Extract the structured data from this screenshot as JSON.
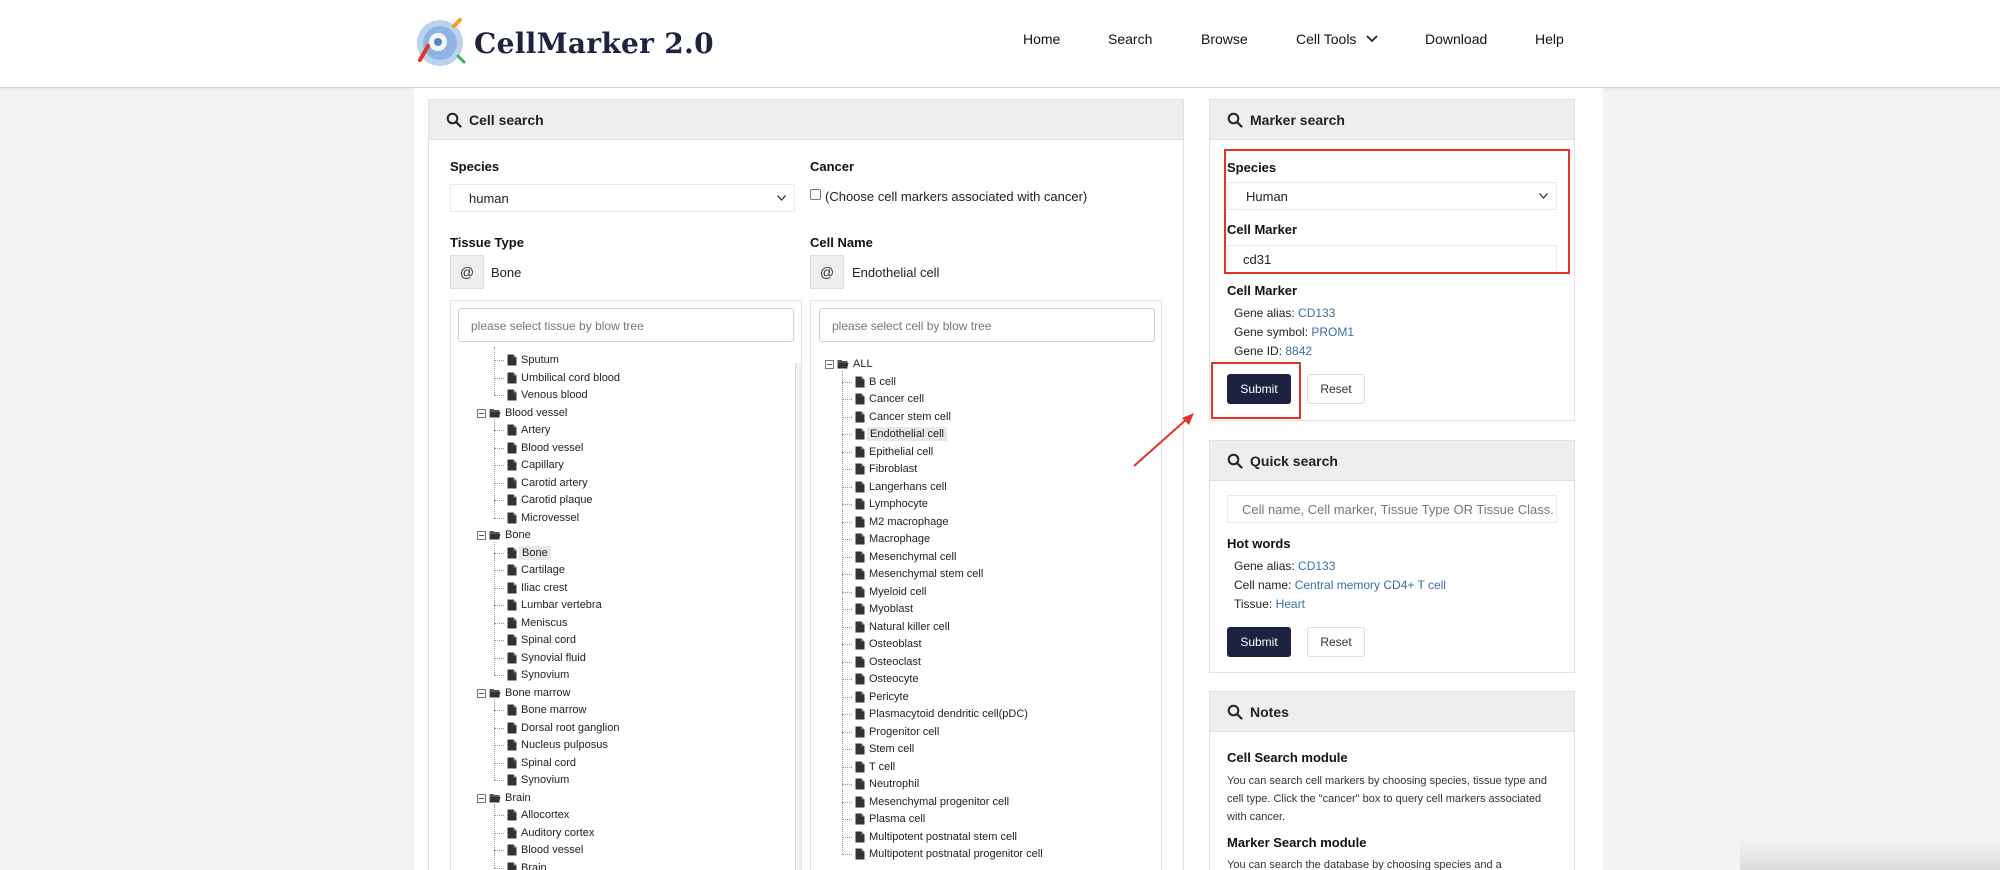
{
  "brand": {
    "name": "CellMarker 2.0"
  },
  "nav": [
    "Home",
    "Search",
    "Browse",
    "Cell Tools",
    "Download",
    "Help"
  ],
  "cell_search": {
    "title": "Cell search",
    "species_label": "Species",
    "species_value": "human",
    "cancer_label": "Cancer",
    "cancer_checkbox_label": "(Choose cell markers associated with cancer)",
    "tissue_label": "Tissue Type",
    "tissue_prefix": "@",
    "tissue_value": "Bone",
    "cell_label": "Cell Name",
    "cell_prefix": "@",
    "cell_value": "Endothelial cell",
    "tissue_tree_placeholder": "please select tissue by blow tree",
    "cell_tree_placeholder": "please select cell by blow tree",
    "tissue_tree": [
      {
        "text": "Sputum",
        "type": "leaf",
        "level": 1
      },
      {
        "text": "Umbilical cord blood",
        "type": "leaf",
        "level": 1
      },
      {
        "text": "Venous blood",
        "type": "leaf",
        "level": 1
      },
      {
        "text": "Blood vessel",
        "type": "folder",
        "level": 0
      },
      {
        "text": "Artery",
        "type": "leaf",
        "level": 1
      },
      {
        "text": "Blood vessel",
        "type": "leaf",
        "level": 1
      },
      {
        "text": "Capillary",
        "type": "leaf",
        "level": 1
      },
      {
        "text": "Carotid artery",
        "type": "leaf",
        "level": 1
      },
      {
        "text": "Carotid plaque",
        "type": "leaf",
        "level": 1
      },
      {
        "text": "Microvessel",
        "type": "leaf",
        "level": 1
      },
      {
        "text": "Bone",
        "type": "folder",
        "level": 0
      },
      {
        "text": "Bone",
        "type": "leaf",
        "level": 1,
        "selected": true
      },
      {
        "text": "Cartilage",
        "type": "leaf",
        "level": 1
      },
      {
        "text": "Iliac crest",
        "type": "leaf",
        "level": 1
      },
      {
        "text": "Lumbar vertebra",
        "type": "leaf",
        "level": 1
      },
      {
        "text": "Meniscus",
        "type": "leaf",
        "level": 1
      },
      {
        "text": "Spinal cord",
        "type": "leaf",
        "level": 1
      },
      {
        "text": "Synovial fluid",
        "type": "leaf",
        "level": 1
      },
      {
        "text": "Synovium",
        "type": "leaf",
        "level": 1
      },
      {
        "text": "Bone marrow",
        "type": "folder",
        "level": 0
      },
      {
        "text": "Bone marrow",
        "type": "leaf",
        "level": 1
      },
      {
        "text": "Dorsal root ganglion",
        "type": "leaf",
        "level": 1
      },
      {
        "text": "Nucleus pulposus",
        "type": "leaf",
        "level": 1
      },
      {
        "text": "Spinal cord",
        "type": "leaf",
        "level": 1
      },
      {
        "text": "Synovium",
        "type": "leaf",
        "level": 1
      },
      {
        "text": "Brain",
        "type": "folder",
        "level": 0
      },
      {
        "text": "Allocortex",
        "type": "leaf",
        "level": 1
      },
      {
        "text": "Auditory cortex",
        "type": "leaf",
        "level": 1
      },
      {
        "text": "Blood vessel",
        "type": "leaf",
        "level": 1
      },
      {
        "text": "Brain",
        "type": "leaf",
        "level": 1
      }
    ],
    "cell_tree": [
      {
        "text": "ALL",
        "type": "folder",
        "level": 0
      },
      {
        "text": "B cell",
        "type": "leaf",
        "level": 1
      },
      {
        "text": "Cancer cell",
        "type": "leaf",
        "level": 1
      },
      {
        "text": "Cancer stem cell",
        "type": "leaf",
        "level": 1
      },
      {
        "text": "Endothelial cell",
        "type": "leaf",
        "level": 1,
        "selected": true
      },
      {
        "text": "Epithelial cell",
        "type": "leaf",
        "level": 1
      },
      {
        "text": "Fibroblast",
        "type": "leaf",
        "level": 1
      },
      {
        "text": "Langerhans cell",
        "type": "leaf",
        "level": 1
      },
      {
        "text": "Lymphocyte",
        "type": "leaf",
        "level": 1
      },
      {
        "text": "M2 macrophage",
        "type": "leaf",
        "level": 1
      },
      {
        "text": "Macrophage",
        "type": "leaf",
        "level": 1
      },
      {
        "text": "Mesenchymal cell",
        "type": "leaf",
        "level": 1
      },
      {
        "text": "Mesenchymal stem cell",
        "type": "leaf",
        "level": 1
      },
      {
        "text": "Myeloid cell",
        "type": "leaf",
        "level": 1
      },
      {
        "text": "Myoblast",
        "type": "leaf",
        "level": 1
      },
      {
        "text": "Natural killer cell",
        "type": "leaf",
        "level": 1
      },
      {
        "text": "Osteoblast",
        "type": "leaf",
        "level": 1
      },
      {
        "text": "Osteoclast",
        "type": "leaf",
        "level": 1
      },
      {
        "text": "Osteocyte",
        "type": "leaf",
        "level": 1
      },
      {
        "text": "Pericyte",
        "type": "leaf",
        "level": 1
      },
      {
        "text": "Plasmacytoid dendritic cell(pDC)",
        "type": "leaf",
        "level": 1
      },
      {
        "text": "Progenitor cell",
        "type": "leaf",
        "level": 1
      },
      {
        "text": "Stem cell",
        "type": "leaf",
        "level": 1
      },
      {
        "text": "T cell",
        "type": "leaf",
        "level": 1
      },
      {
        "text": "Neutrophil",
        "type": "leaf",
        "level": 1
      },
      {
        "text": "Mesenchymal progenitor cell",
        "type": "leaf",
        "level": 1
      },
      {
        "text": "Plasma cell",
        "type": "leaf",
        "level": 1
      },
      {
        "text": "Multipotent postnatal stem cell",
        "type": "leaf",
        "level": 1
      },
      {
        "text": "Multipotent postnatal progenitor cell",
        "type": "leaf",
        "level": 1
      }
    ]
  },
  "marker_search": {
    "title": "Marker search",
    "species_label": "Species",
    "species_value": "Human",
    "marker_label": "Cell Marker",
    "marker_value": "cd31",
    "example_label": "Cell Marker",
    "alias_label": "Gene alias:",
    "alias_value": "CD133",
    "symbol_label": "Gene symbol:",
    "symbol_value": "PROM1",
    "geneid_label": "Gene ID:",
    "geneid_value": "8842",
    "submit": "Submit",
    "reset": "Reset"
  },
  "quick_search": {
    "title": "Quick search",
    "placeholder": "Cell name, Cell marker, Tissue Type OR Tissue Class.",
    "hot_label": "Hot words",
    "alias_label": "Gene alias:",
    "alias_value": "CD133",
    "cellname_label": "Cell name:",
    "cellname_value": "Central memory CD4+ T cell",
    "tissue_label": "Tissue:",
    "tissue_value": "Heart",
    "submit": "Submit",
    "reset": "Reset"
  },
  "notes": {
    "title": "Notes",
    "cell_heading": "Cell Search module",
    "cell_text": "You can search cell markers by choosing species, tissue type and cell type. Click the \"cancer\" box to query cell markers associated with cancer.",
    "marker_heading": "Marker Search module",
    "marker_text": "You can search the database by choosing species and a"
  },
  "colors": {
    "brand_dark": "#1c2240",
    "link": "#3a6fa8",
    "highlight": "#e2352a",
    "panel_head": "#eeeeee"
  }
}
